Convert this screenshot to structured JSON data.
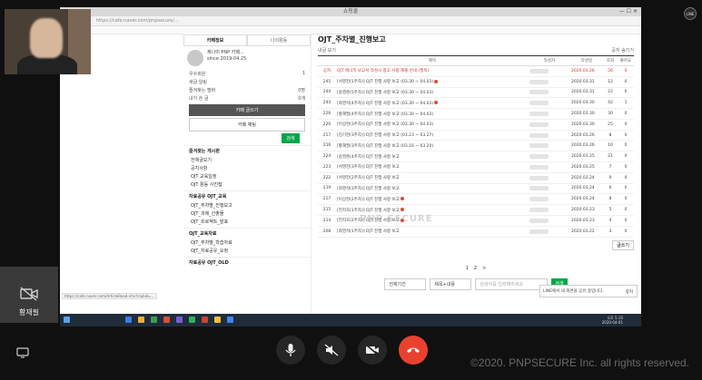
{
  "call": {
    "participant_name": "황재필",
    "copyright": "©2020. PNPSECURE Inc. all rights reserved.",
    "shared_window_title": "쇼핑몰",
    "watermark": "PNP SECURE"
  },
  "browser": {
    "address": "https://cafe.naver.com/pnpsecure/...",
    "bookmarks": "인증보고서",
    "status_url": "https://cafe.naver.com/ArticleRead.nhn?clubid=..."
  },
  "cafe_sidebar": {
    "tab_info": "카페정보",
    "tab_activity": "나의활동",
    "member_name": "제나미 PNP 카페...",
    "join_date": "since 2019.04.25",
    "stats": [
      {
        "label": "우수회원",
        "value": "1"
      },
      {
        "label": "새글 알림",
        "value": ""
      },
      {
        "label": "즐겨찾는 멤버",
        "value": "0명"
      },
      {
        "label": "내가 쓴 글",
        "value": "0개"
      }
    ],
    "write_button": "카페 글쓰기",
    "chat_button": "카페 채팅",
    "green_button": "검색",
    "menu_head_1": "즐겨찾는 게시판",
    "menu_items_1": [
      "전체글보기",
      "공지사항",
      "OJT 교육일정",
      "OJT 활동 사진첩"
    ],
    "menu_head_2": "자료공유 OJT_교육",
    "menu_items_2": [
      "OJT_주차별_진행보고",
      "OJT_과제_산출물",
      "OJT_프로젝트_발표"
    ],
    "menu_head_3": "OJT_교육자료",
    "menu_items_3": [
      "OJT_주차별_학습자료",
      "OJT_자료공유_요청"
    ],
    "menu_head_4": "자료공유 OJT_OLD"
  },
  "board": {
    "title": "OJT_주차별_진행보고",
    "toolbar_left": "내글 보기",
    "toolbar_right": "공지 숨기기",
    "columns": [
      "",
      "제목",
      "작성자",
      "작성일",
      "조회",
      "좋아요"
    ],
    "notice": {
      "num": "공지",
      "title": "OJT 에너지 보고서 작성시 참고 사항 제출 안내 (필독)",
      "date": "2020.03.26",
      "views": "56",
      "likes": "0"
    },
    "rows": [
      {
        "num": "245",
        "title": "[서영진(1주차)] OJT 진행 사항 보고 (03.30 ~ 04.03)",
        "date": "2020.03.31",
        "views": "12",
        "likes": "0",
        "dot": true
      },
      {
        "num": "244",
        "title": "[송영준(5주차)] OJT 진행 사항 보고 (03.30 ~ 04.03)",
        "date": "2020.03.31",
        "views": "23",
        "likes": "0",
        "dot": false
      },
      {
        "num": "243",
        "title": "[최영석(4주차)] OJT 진행 사항 보고 (03.30 ~ 04.03)",
        "date": "2020.03.30",
        "views": "42",
        "likes": "1",
        "dot": true
      },
      {
        "num": "226",
        "title": "[황재필(4주차)] OJT 진행 사항 보고 (03.30 ~ 04.03)",
        "date": "2020.03.30",
        "views": "30",
        "likes": "0",
        "dot": false
      },
      {
        "num": "220",
        "title": "[이상현(3주차)] OJT 진행 사항 보고 (03.30 ~ 04.03)",
        "date": "2020.03.30",
        "views": "25",
        "likes": "0",
        "dot": false
      },
      {
        "num": "217",
        "title": "[김기현(3주차)] OJT 진행 사항 보고 (03.23 ~ 03.27)",
        "date": "2020.03.26",
        "views": "8",
        "likes": "0",
        "dot": false
      },
      {
        "num": "216",
        "title": "[황재필(3주차)] OJT 진행 사항 보고 (03.16 ~ 03.20)",
        "date": "2020.03.26",
        "views": "10",
        "likes": "0",
        "dot": false
      },
      {
        "num": "224",
        "title": "[송영준(4주차)] OJT 진행 사항 보고",
        "date": "2020.03.25",
        "views": "21",
        "likes": "0",
        "dot": false
      },
      {
        "num": "223",
        "title": "[서영진(3주차)] OJT 진행 사항 보고",
        "date": "2020.03.25",
        "views": "7",
        "likes": "0",
        "dot": false
      },
      {
        "num": "222",
        "title": "[서영진(2주차)] OJT 진행 사항 보고",
        "date": "2020.03.24",
        "views": "9",
        "likes": "0",
        "dot": false
      },
      {
        "num": "219",
        "title": "[최영석(3주차)] OJT 진행 사항 보고",
        "date": "2020.03.24",
        "views": "6",
        "likes": "0",
        "dot": false
      },
      {
        "num": "217",
        "title": "[이상현(2주차)] OJT 진행 사항 보고",
        "date": "2020.03.24",
        "views": "8",
        "likes": "0",
        "dot": true
      },
      {
        "num": "215",
        "title": "[전지호(1주차)] OJT 진행 사항 보고",
        "date": "2020.03.23",
        "views": "5",
        "likes": "0",
        "dot": true
      },
      {
        "num": "214",
        "title": "[전지호(2주차)] OJT 진행 사항 보고",
        "date": "2020.03.23",
        "views": "4",
        "likes": "0",
        "dot": true
      },
      {
        "num": "208",
        "title": "[최영석(1주차)] OJT 진행 사항 보고",
        "date": "2020.03.22",
        "views": "3",
        "likes": "0",
        "dot": false
      }
    ],
    "write_button": "글쓰기",
    "pages": [
      "1",
      "2",
      ">"
    ],
    "search_period": "전체기간",
    "search_type": "제목+내용",
    "search_placeholder": "검색어를 입력해주세요",
    "search_button": "검색"
  },
  "taskbar": {
    "time": "오후 5:10",
    "date": "2020-04-01"
  },
  "toast": {
    "text": "LINE에서 내 화면을 공유 중입니다.",
    "button": "중지"
  },
  "colors": {
    "end_call": "#e8422e",
    "naver_green": "#03a64a"
  }
}
